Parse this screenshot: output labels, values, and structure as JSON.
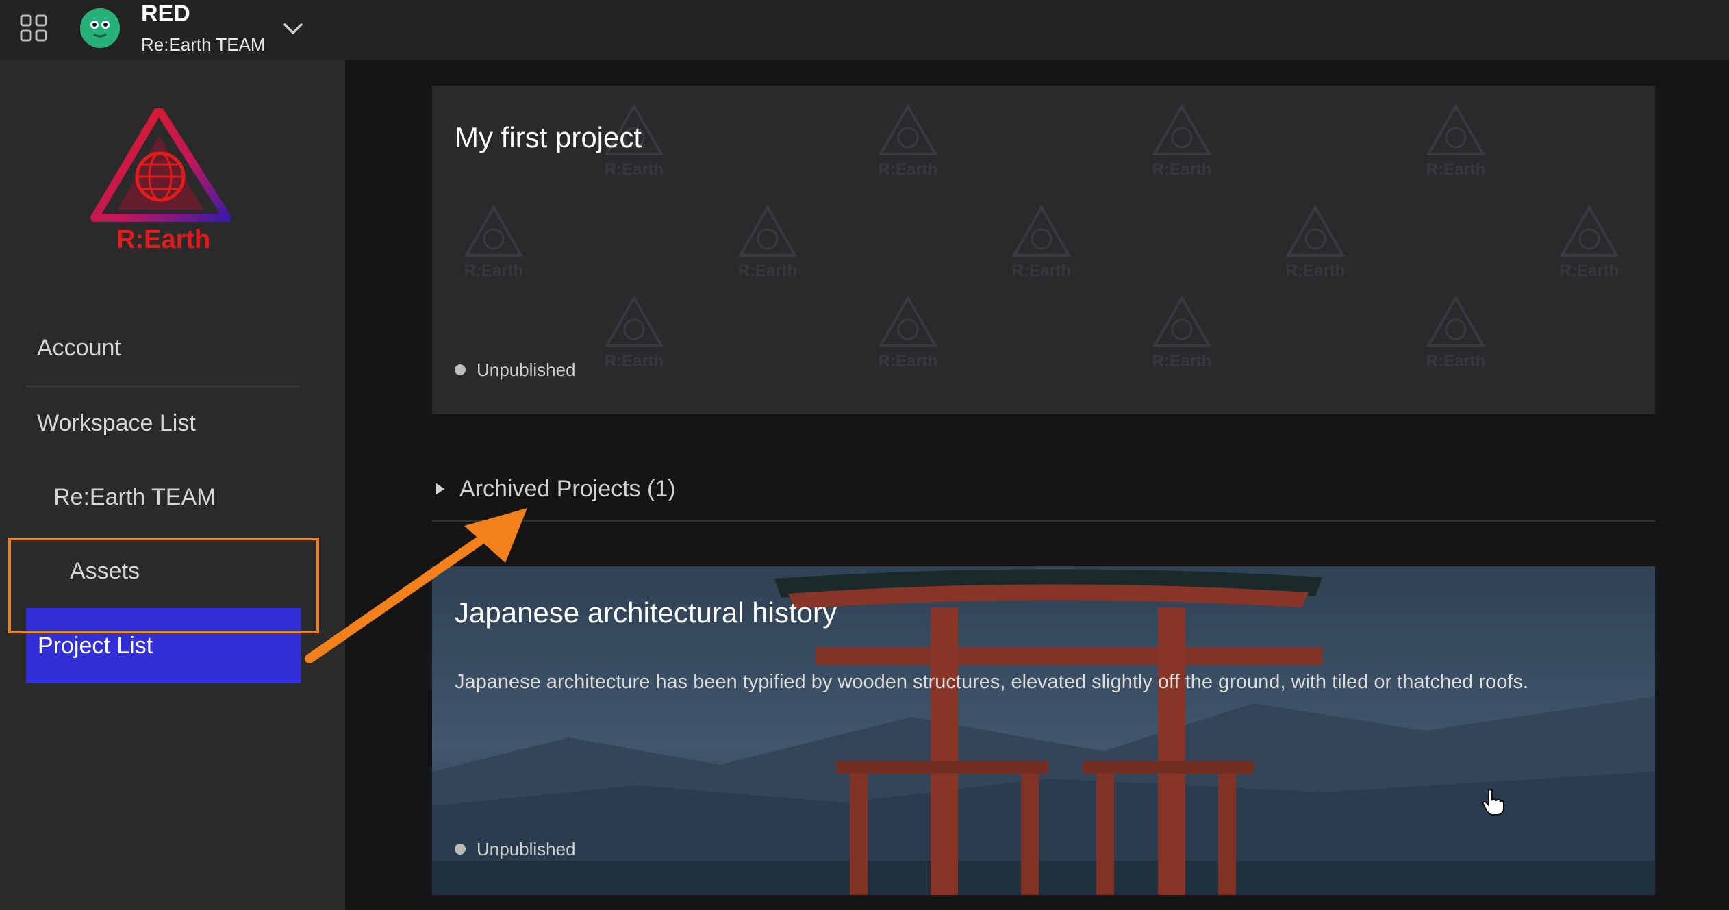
{
  "header": {
    "user_name": "RED",
    "team_name": "Re:Earth TEAM"
  },
  "sidebar": {
    "logo_text": "R:Earth",
    "items": [
      {
        "label": "Account"
      },
      {
        "label": "Workspace List"
      },
      {
        "label": "Re:Earth TEAM"
      },
      {
        "label": "Assets"
      },
      {
        "label": "Project List",
        "active": true
      }
    ]
  },
  "projects": [
    {
      "title": "My first project",
      "description": "",
      "status": "Unpublished",
      "watermark_text": "R:Earth"
    },
    {
      "title": "Japanese architectural history",
      "description": "Japanese architecture has been typified by wooden structures, elevated slightly off the ground, with tiled or thatched roofs.",
      "status": "Unpublished"
    }
  ],
  "archived": {
    "label": "Archived Projects (1)"
  },
  "colors": {
    "accent_active": "#3030d6",
    "annotation": "#f2811d",
    "logo_red": "#e31b1b"
  },
  "icons": [
    "apps-grid-icon",
    "avatar-icon",
    "chevron-down-icon",
    "caret-right-icon",
    "hand-cursor-icon"
  ]
}
